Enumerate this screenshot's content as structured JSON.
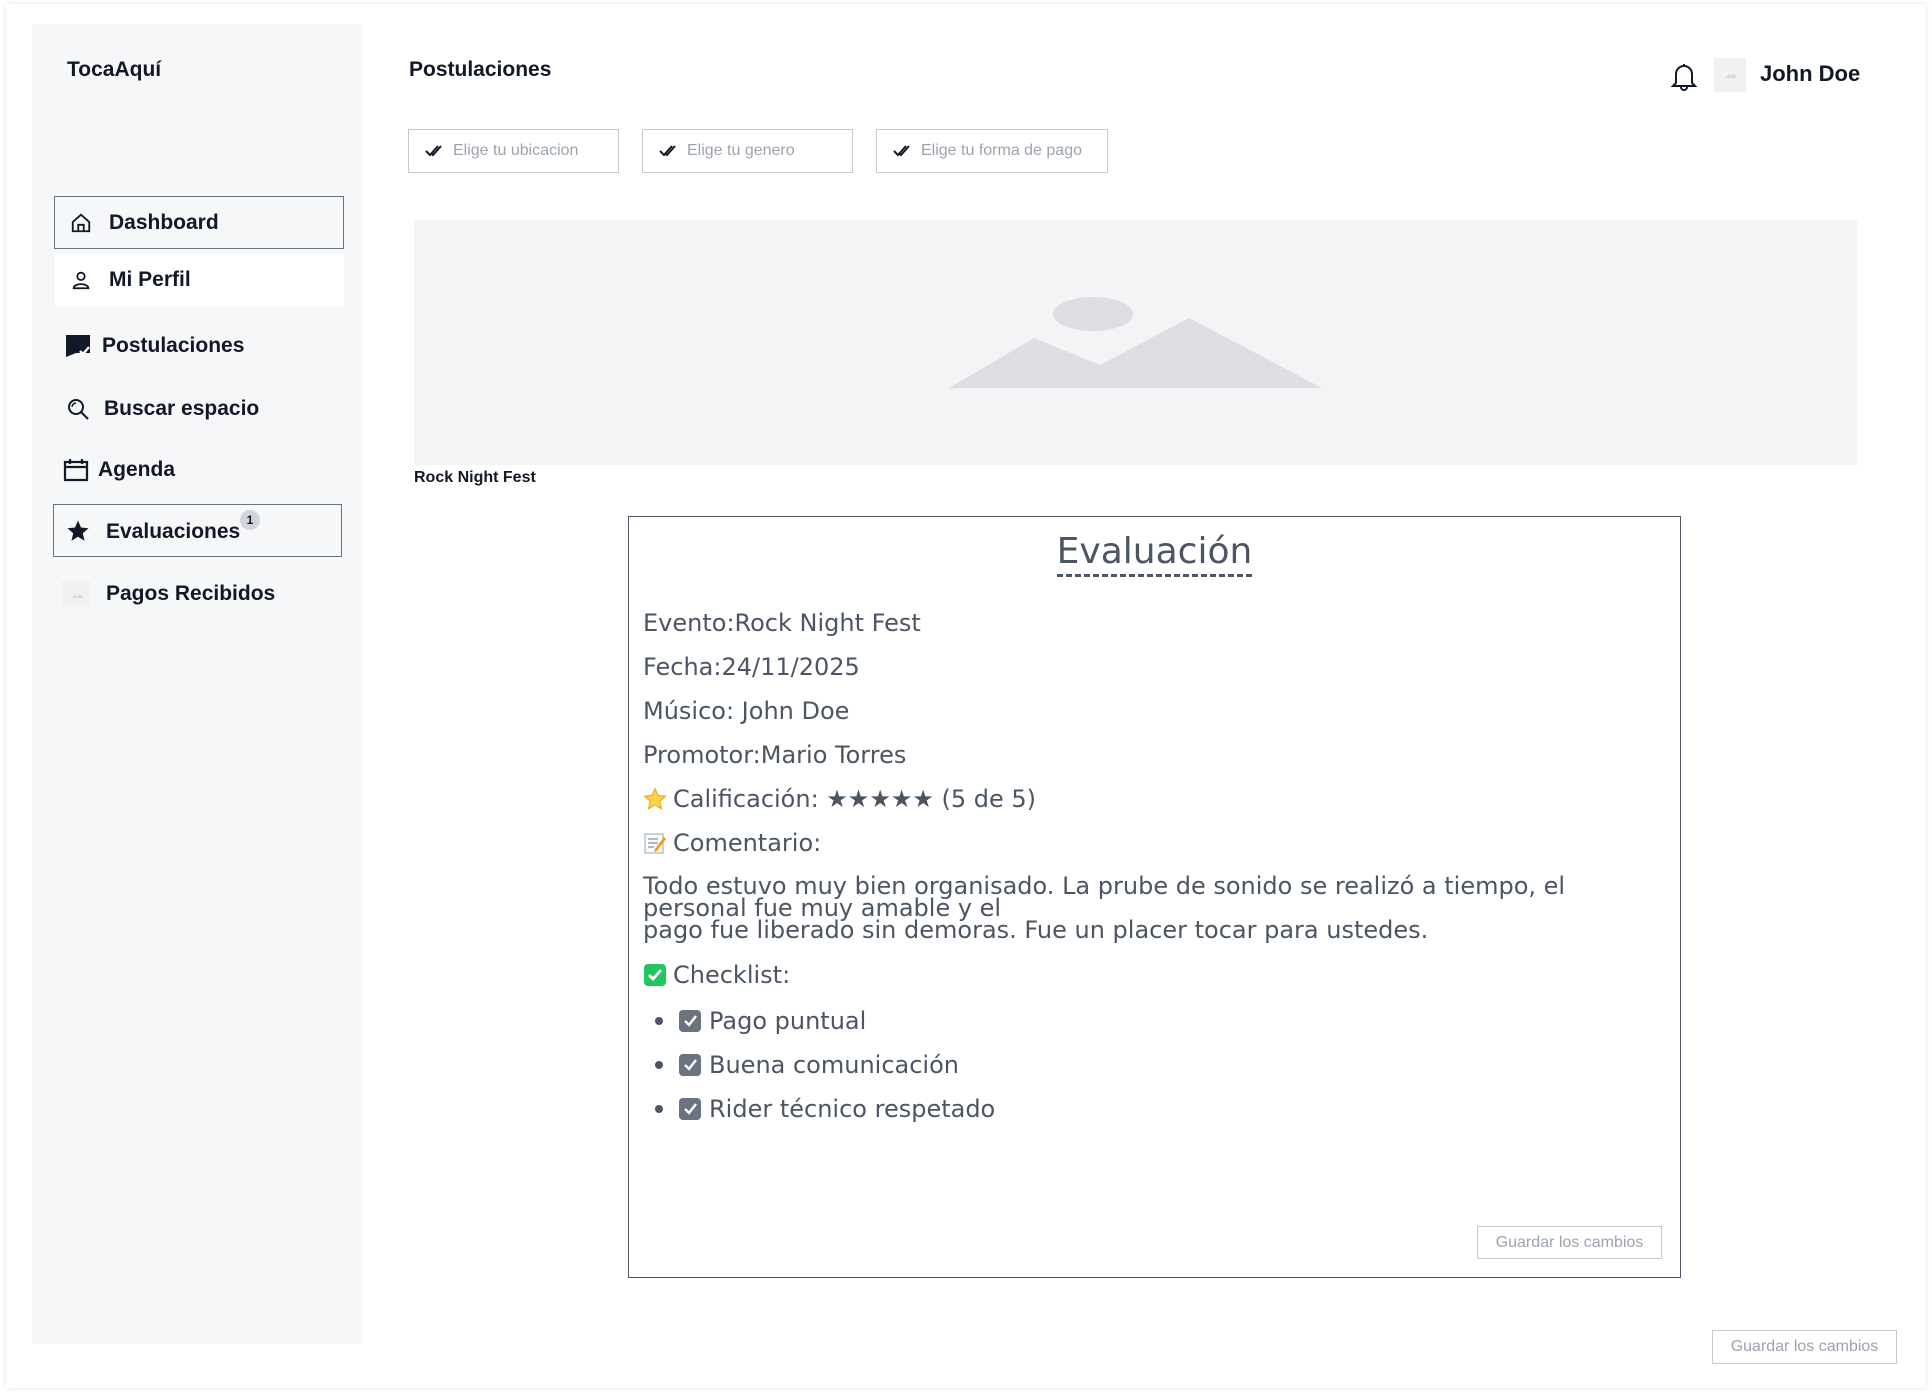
{
  "app": {
    "brand": "TocaAquí"
  },
  "sidebar": {
    "items": [
      {
        "label": "Dashboard",
        "icon": "home-icon"
      },
      {
        "label": "Mi Perfil",
        "icon": "user-icon"
      },
      {
        "label": "Postulaciones",
        "icon": "flag-check-icon"
      },
      {
        "label": "Buscar espacio",
        "icon": "search-icon"
      },
      {
        "label": "Agenda",
        "icon": "calendar-icon"
      },
      {
        "label": "Evaluaciones",
        "icon": "star-icon",
        "badge": "1"
      },
      {
        "label": "Pagos Recibidos",
        "icon": "image-placeholder-icon"
      }
    ]
  },
  "header": {
    "title": "Postulaciones",
    "user_name": "John Doe"
  },
  "filters": [
    {
      "placeholder": "Elige tu ubicacion"
    },
    {
      "placeholder": "Elige tu genero"
    },
    {
      "placeholder": "Elige tu forma de pago"
    }
  ],
  "banner": {
    "caption": "Rock Night Fest"
  },
  "evaluation": {
    "title": "Evaluación",
    "evento": "Evento:Rock Night Fest",
    "fecha": "Fecha:24/11/2025",
    "musico": "Músico: John Doe",
    "promotor": "Promotor:Mario Torres",
    "calificacion": "Calificación: ★★★★★ (5 de 5)",
    "comentario_label": "Comentario:",
    "comentario": "Todo estuvo muy bien organisado. La prube de sonido se realizó a tiempo, el personal fue muy amable y el",
    "comentario_2": "pago fue liberado sin demoras. Fue un placer tocar para ustedes.",
    "checklist_label": "Checklist:",
    "checklist": [
      "Pago puntual",
      "Buena comunicación",
      "Rider técnico respetado"
    ],
    "save_label": "Guardar los cambios"
  },
  "footer": {
    "save_label": "Guardar los cambios"
  },
  "colors": {
    "sidebar_bg": "#f6f7f9",
    "text_gray": "#4b5563",
    "check_green": "#22c55e",
    "star_yellow": "#fbbf24"
  }
}
